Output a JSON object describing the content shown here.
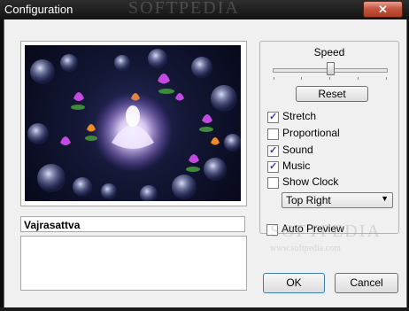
{
  "window": {
    "title": "Configuration",
    "close_symbol": "✕"
  },
  "watermark": {
    "main": "SOFTPEDIA",
    "url": "www.softpedia.com"
  },
  "preview": {
    "name": "Vajrasattva",
    "description": ""
  },
  "settings": {
    "speed_label": "Speed",
    "speed_value": 0.53,
    "reset_label": "Reset",
    "checkboxes": [
      {
        "label": "Stretch",
        "checked": true
      },
      {
        "label": "Proportional",
        "checked": false
      },
      {
        "label": "Sound",
        "checked": true
      },
      {
        "label": "Music",
        "checked": true
      },
      {
        "label": "Show Clock",
        "checked": false
      }
    ],
    "clock_position": "Top Right",
    "auto_preview": {
      "label": "Auto Preview",
      "checked": false
    }
  },
  "buttons": {
    "ok": "OK",
    "cancel": "Cancel"
  }
}
